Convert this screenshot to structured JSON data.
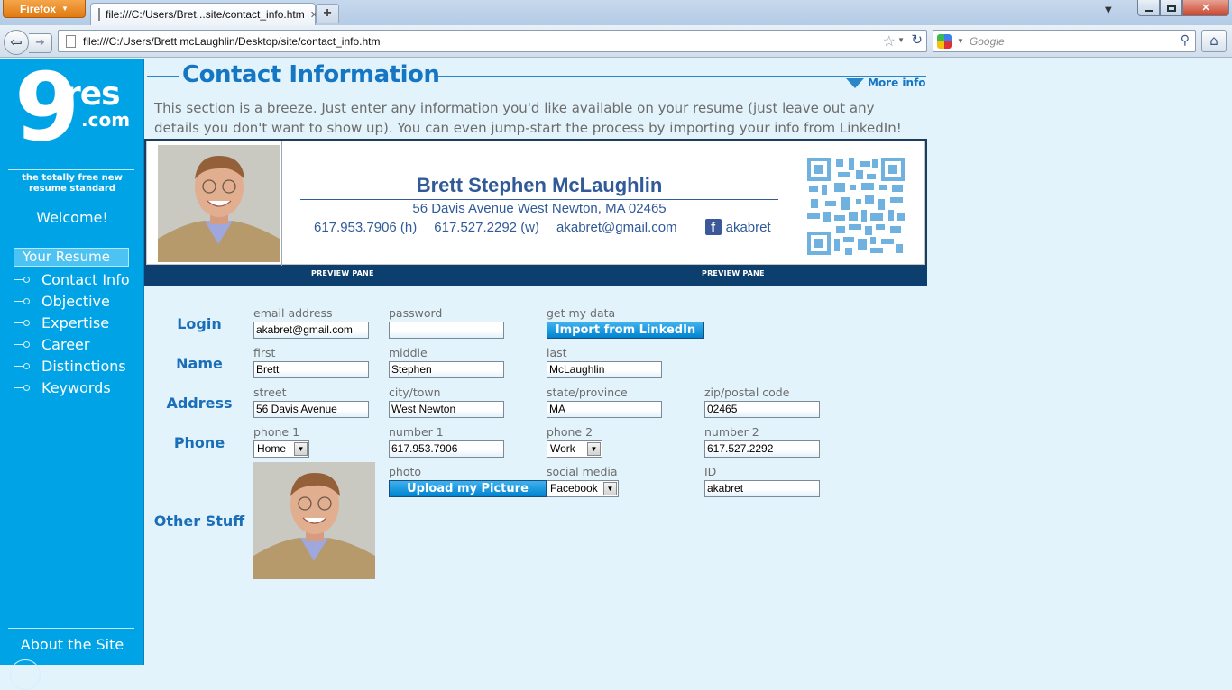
{
  "browser": {
    "app_button": "Firefox",
    "tab_title": "file:///C:/Users/Bret...site/contact_info.htm",
    "new_tab": "+",
    "url": "file:///C:/Users/Brett mcLaughlin/Desktop/site/contact_info.htm",
    "search_placeholder": "Google"
  },
  "sidebar": {
    "logo_nine": "9",
    "logo_res": "res",
    "logo_com": ".com",
    "tagline": "the totally free new resume standard",
    "welcome": "Welcome!",
    "section": "Your Resume",
    "items": [
      {
        "label": "Contact Info"
      },
      {
        "label": "Objective"
      },
      {
        "label": "Expertise"
      },
      {
        "label": "Career"
      },
      {
        "label": "Distinctions"
      },
      {
        "label": "Keywords"
      }
    ],
    "about": "About the Site"
  },
  "main": {
    "title": "Contact Information",
    "more_info": "More info",
    "intro": "This section is a breeze. Just enter any information you'd like available on your resume (just leave out any details you don't want to show up).   You can even jump-start the process by importing your info from LinkedIn!"
  },
  "preview": {
    "name": "Brett Stephen McLaughlin",
    "address": "56 Davis Avenue West Newton, MA  02465",
    "phone_home": "617.953.7906 (h)",
    "phone_work": "617.527.2292 (w)",
    "email": "akabret@gmail.com",
    "social_glyph": "f",
    "social": "akabret",
    "bar_label_left": "PREVIEW PANE",
    "bar_label_right": "PREVIEW PANE"
  },
  "form": {
    "login": {
      "label": "Login",
      "email_label": "email address",
      "email": "akabret@gmail.com",
      "password_label": "password",
      "password": "",
      "getdata_label": "get my data",
      "import_button": "Import from LinkedIn"
    },
    "name": {
      "label": "Name",
      "first_label": "first",
      "first": "Brett",
      "middle_label": "middle",
      "middle": "Stephen",
      "last_label": "last",
      "last": "McLaughlin"
    },
    "address": {
      "label": "Address",
      "street_label": "street",
      "street": "56 Davis Avenue",
      "city_label": "city/town",
      "city": "West Newton",
      "state_label": "state/province",
      "state": "MA",
      "zip_label": "zip/postal code",
      "zip": "02465"
    },
    "phone": {
      "label": "Phone",
      "phone1_label": "phone 1",
      "phone1_type": "Home",
      "number1_label": "number 1",
      "number1": "617.953.7906",
      "phone2_label": "phone 2",
      "phone2_type": "Work",
      "number2_label": "number 2",
      "number2": "617.527.2292"
    },
    "other": {
      "label": "Other Stuff",
      "photo_label": "photo",
      "upload_button": "Upload my Picture",
      "social_label": "social media",
      "social_type": "Facebook",
      "id_label": "ID",
      "id": "akabret"
    }
  },
  "colors": {
    "sidebar": "#00a4e6",
    "accent": "#1576c4",
    "preview_bar": "#0d3f6e",
    "page_bg": "#e3f3fb"
  }
}
